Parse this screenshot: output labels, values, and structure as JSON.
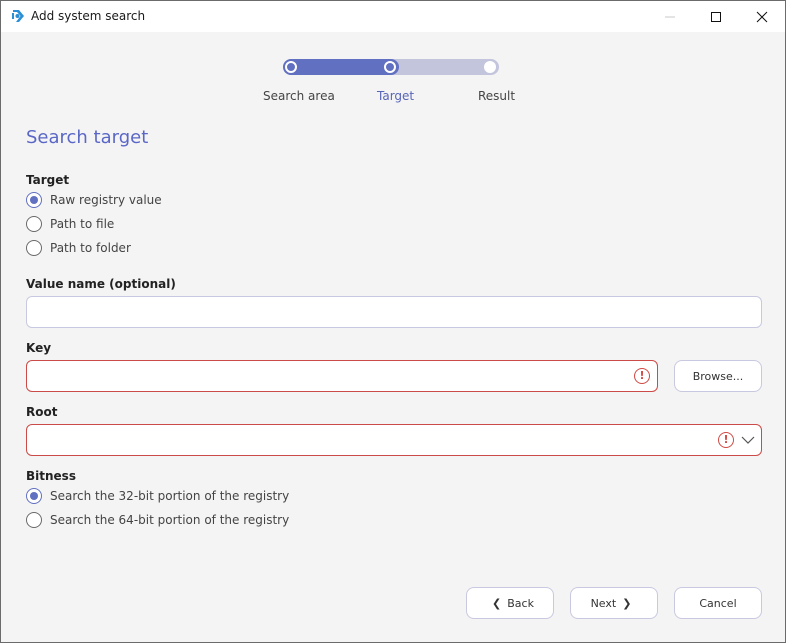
{
  "window": {
    "title": "Add system search",
    "app_icon": "app-logo-icon",
    "controls": {
      "minimize": "minimize-icon",
      "maximize": "maximize-icon",
      "close": "close-icon"
    }
  },
  "stepper": {
    "steps": [
      {
        "label": "Search area",
        "state": "done"
      },
      {
        "label": "Target",
        "state": "active"
      },
      {
        "label": "Result",
        "state": "pending"
      }
    ],
    "progress_percent": 50,
    "colors": {
      "fill": "#6270c2",
      "track": "#c3c5dd",
      "active_label": "#5865b8"
    }
  },
  "page": {
    "title": "Search target"
  },
  "target": {
    "label": "Target",
    "options": [
      {
        "label": "Raw registry value",
        "checked": true
      },
      {
        "label": "Path to file",
        "checked": false
      },
      {
        "label": "Path to folder",
        "checked": false
      }
    ]
  },
  "value_name": {
    "label": "Value name (optional)",
    "value": "",
    "placeholder": ""
  },
  "key": {
    "label": "Key",
    "value": "",
    "error_icon": "error-icon",
    "browse_label": "Browse..."
  },
  "root": {
    "label": "Root",
    "selected": "",
    "error_icon": "error-icon",
    "dropdown_icon": "chevron-down-icon"
  },
  "bitness": {
    "label": "Bitness",
    "options": [
      {
        "label": "Search the 32-bit portion of the registry",
        "checked": true
      },
      {
        "label": "Search the 64-bit portion of the registry",
        "checked": false
      }
    ]
  },
  "footer": {
    "back_label": "Back",
    "next_label": "Next",
    "cancel_label": "Cancel",
    "back_glyph": "❮",
    "next_glyph": "❯"
  },
  "colors": {
    "accent": "#5a67c6",
    "error": "#cc4b48"
  }
}
